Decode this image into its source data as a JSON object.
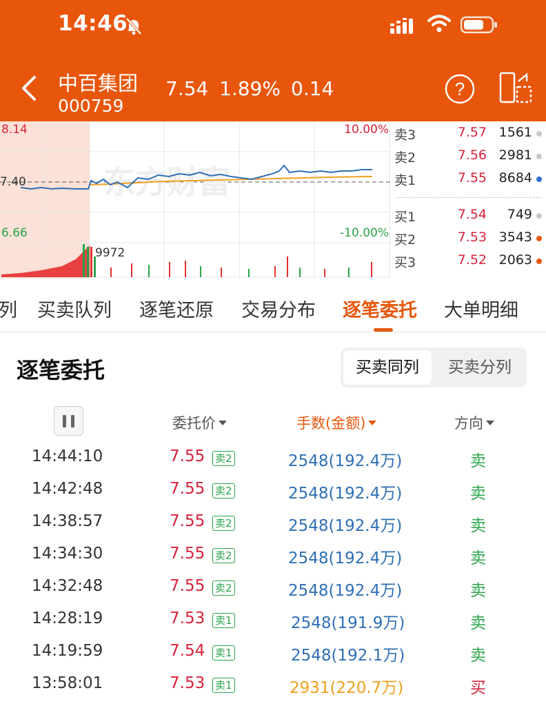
{
  "status_bar": {
    "time": "14:46"
  },
  "header": {
    "stock_name": "中百集团",
    "stock_code": "000759",
    "price": "7.54",
    "change_pct": "1.89%",
    "change": "0.14"
  },
  "chart": {
    "high_label": "8.14",
    "mid_label": "7.40",
    "low_label": "6.66",
    "up_pct_label": "10.00%",
    "down_pct_label": "-10.00%",
    "volume_label": "9972",
    "watermark": "东方财富"
  },
  "orderbook": {
    "asks": [
      {
        "level": "卖3",
        "price": "7.57",
        "volume": "1561",
        "dot_color": "#c8c8c8"
      },
      {
        "level": "卖2",
        "price": "7.56",
        "volume": "2981",
        "dot_color": "#c8c8c8"
      },
      {
        "level": "卖1",
        "price": "7.55",
        "volume": "8684",
        "dot_color": "#2e6fd0"
      }
    ],
    "bids": [
      {
        "level": "买1",
        "price": "7.54",
        "volume": "749",
        "dot_color": "#c8c8c8"
      },
      {
        "level": "买2",
        "price": "7.53",
        "volume": "3543",
        "dot_color": "#e8560c"
      },
      {
        "level": "买3",
        "price": "7.52",
        "volume": "2063",
        "dot_color": "#e8560c"
      }
    ]
  },
  "tabs": [
    {
      "label": "列"
    },
    {
      "label": "买卖队列"
    },
    {
      "label": "逐笔还原"
    },
    {
      "label": "交易分布"
    },
    {
      "label": "逐笔委托"
    },
    {
      "label": "大单明细"
    }
  ],
  "active_tab": "逐笔委托",
  "section": {
    "title": "逐笔委托",
    "toggle_active": "买卖同列",
    "toggle_inactive": "买卖分列"
  },
  "table": {
    "headers": {
      "price": "委托价",
      "volume": "手数(金额)",
      "direction": "方向"
    },
    "rows": [
      {
        "time": "14:44:10",
        "price": "7.55",
        "tag": "卖2",
        "volume": "2548(192.4万)",
        "direction": "卖"
      },
      {
        "time": "14:42:48",
        "price": "7.55",
        "tag": "卖2",
        "volume": "2548(192.4万)",
        "direction": "卖"
      },
      {
        "time": "14:38:57",
        "price": "7.55",
        "tag": "卖2",
        "volume": "2548(192.4万)",
        "direction": "卖"
      },
      {
        "time": "14:34:30",
        "price": "7.55",
        "tag": "卖2",
        "volume": "2548(192.4万)",
        "direction": "卖"
      },
      {
        "time": "14:32:48",
        "price": "7.55",
        "tag": "卖2",
        "volume": "2548(192.4万)",
        "direction": "卖"
      },
      {
        "time": "14:28:19",
        "price": "7.53",
        "tag": "卖1",
        "volume": "2548(191.9万)",
        "direction": "卖"
      },
      {
        "time": "14:19:59",
        "price": "7.54",
        "tag": "卖1",
        "volume": "2548(192.1万)",
        "direction": "卖"
      },
      {
        "time": "13:58:01",
        "price": "7.53",
        "tag": "卖1",
        "volume": "2931(220.7万)",
        "direction": "买"
      }
    ]
  },
  "colors": {
    "brand": "#e8560c",
    "up": "#d6223a",
    "down": "#2aa34a",
    "link_blue": "#2e6fb5",
    "buy_volume": "#f0a020"
  }
}
